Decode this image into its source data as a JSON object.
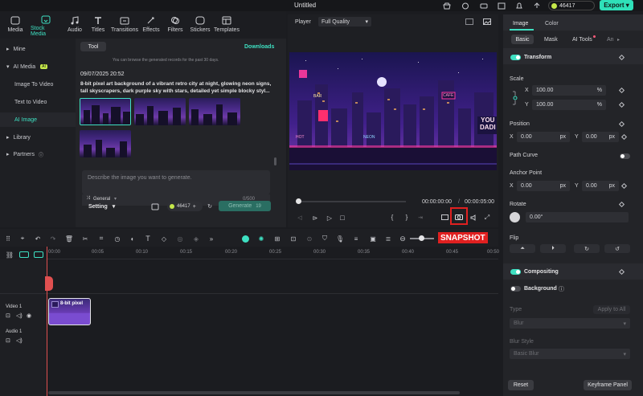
{
  "app": {
    "title": "Untitled",
    "credits": "46417",
    "export_label": "Export"
  },
  "toolbar": {
    "items": [
      {
        "label": "Media",
        "icon": "media-icon"
      },
      {
        "label": "Stock Media",
        "icon": "stock-media-icon"
      },
      {
        "label": "Audio",
        "icon": "audio-icon"
      },
      {
        "label": "Titles",
        "icon": "titles-icon"
      },
      {
        "label": "Transitions",
        "icon": "transitions-icon"
      },
      {
        "label": "Effects",
        "icon": "effects-icon"
      },
      {
        "label": "Filters",
        "icon": "filters-icon"
      },
      {
        "label": "Stickers",
        "icon": "stickers-icon"
      },
      {
        "label": "Templates",
        "icon": "templates-icon"
      }
    ]
  },
  "sidebar": {
    "mine": "Mine",
    "ai_media": "AI Media",
    "ai_badge": "AI",
    "image_to_video": "Image To Video",
    "text_to_video": "Text to Video",
    "ai_image": "AI Image",
    "library": "Library",
    "partners": "Partners"
  },
  "media": {
    "tool_tab": "Tool",
    "downloads": "Downloads",
    "notice": "You can browse the generated records for the past 30 days.",
    "date": "09/07/2025 20:52",
    "prompt": "8-bit pixel art background of a vibrant retro city at night, glowing neon signs, tall skyscrapers, dark purple sky with stars, detailed yet simple blocky styl...",
    "input_placeholder": "Describe the image you want to generate.",
    "model": "General",
    "count": "0/500",
    "setting": "Setting",
    "credits": "46417",
    "generate": "Generate",
    "generate_cost": "19"
  },
  "player": {
    "label": "Player",
    "quality": "Full Quality",
    "time_current": "00:00:00:00",
    "time_sep": "/",
    "time_total": "00:00:05:00",
    "neon_signs": [
      "YOU",
      "DADI",
      "BAR",
      "CAFE",
      "HOT",
      "NEON"
    ]
  },
  "timeline": {
    "ruler": [
      "00:00",
      "00:05",
      "00:10",
      "00:15",
      "00:20",
      "00:25",
      "00:30",
      "00:35",
      "00:40",
      "00:45",
      "00:50"
    ],
    "clip_label": "8-bit pixel",
    "video_track": "Video 1",
    "audio_track": "Audio 1",
    "snapshot": "SNAPSHOT"
  },
  "right": {
    "tab_image": "Image",
    "tab_color": "Color",
    "subtabs": [
      "Basic",
      "Mask",
      "AI Tools",
      "An"
    ],
    "transform": "Transform",
    "scale": "Scale",
    "x": "X",
    "y": "Y",
    "scale_x": "100.00",
    "scale_y": "100.00",
    "pct": "%",
    "position": "Position",
    "pos_x": "0.00",
    "pos_y": "0.00",
    "px": "px",
    "path_curve": "Path Curve",
    "anchor_point": "Anchor Point",
    "anchor_x": "0.00",
    "anchor_y": "0.00",
    "rotate": "Rotate",
    "rotate_val": "0.00°",
    "flip": "Flip",
    "compositing": "Compositing",
    "background": "Background",
    "type": "Type",
    "apply_all": "Apply to All",
    "blur": "Blur",
    "blur_style": "Blur Style",
    "basic_blur": "Basic Blur",
    "reset": "Reset",
    "keyframe_panel": "Keyframe Panel"
  },
  "colors": {
    "accent": "#3ee0c2",
    "export": "#2fe0b9",
    "highlight": "#e02020"
  }
}
